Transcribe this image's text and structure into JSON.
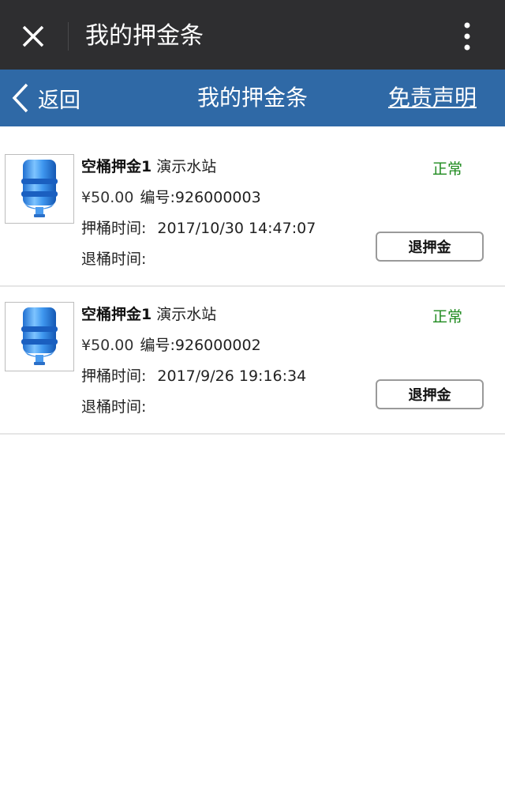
{
  "topbar": {
    "title": "我的押金条",
    "close_icon": "close-icon",
    "more_icon": "more-vertical-icon"
  },
  "navbar": {
    "back_label": "返回",
    "title": "我的押金条",
    "disclaimer": "免责声明",
    "background_color": "#2f69a6"
  },
  "items": [
    {
      "name": "空桶押金1",
      "station": "演示水站",
      "price": "¥50.00",
      "number_label": "编号:",
      "number": "926000003",
      "deposit_time_label": "押桶时间:",
      "deposit_time": "2017/10/30 14:47:07",
      "return_time_label": "退桶时间:",
      "return_time": "",
      "status": "正常",
      "action_label": "退押金"
    },
    {
      "name": "空桶押金1",
      "station": "演示水站",
      "price": "¥50.00",
      "number_label": "编号:",
      "number": "926000002",
      "deposit_time_label": "押桶时间:",
      "deposit_time": "2017/9/26 19:16:34",
      "return_time_label": "退桶时间:",
      "return_time": "",
      "status": "正常",
      "action_label": "退押金"
    }
  ]
}
